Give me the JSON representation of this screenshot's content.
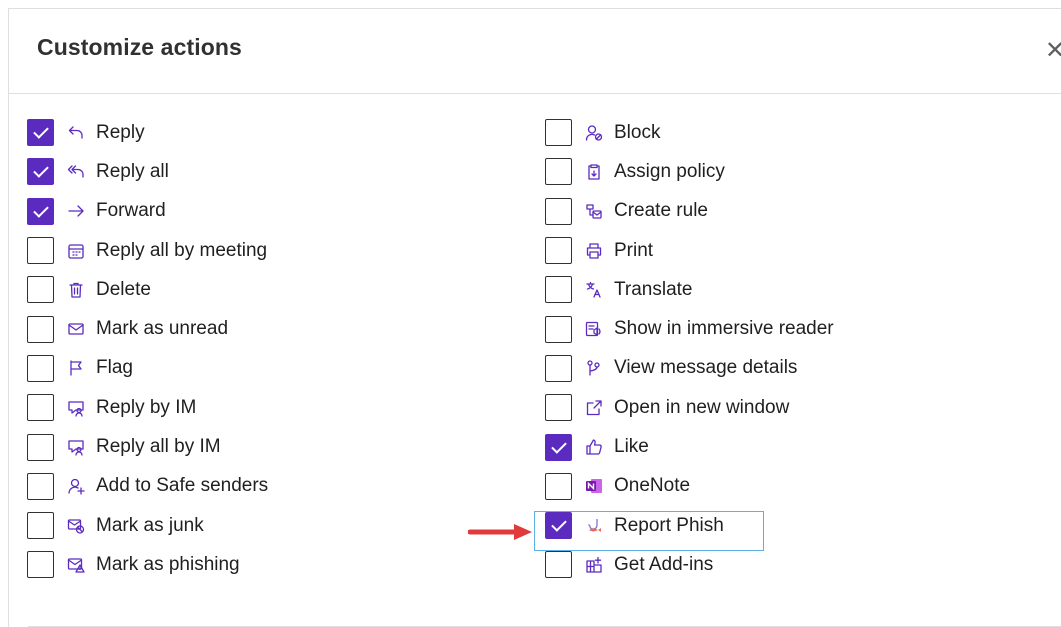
{
  "dialog": {
    "title": "Customize actions",
    "close_glyph": "✕"
  },
  "left_actions": [
    {
      "label": "Reply",
      "checked": true,
      "icon": "reply-icon"
    },
    {
      "label": "Reply all",
      "checked": true,
      "icon": "reply-all-icon"
    },
    {
      "label": "Forward",
      "checked": true,
      "icon": "forward-icon"
    },
    {
      "label": "Reply all by meeting",
      "checked": false,
      "icon": "calendar-icon"
    },
    {
      "label": "Delete",
      "checked": false,
      "icon": "trash-icon"
    },
    {
      "label": "Mark as unread",
      "checked": false,
      "icon": "envelope-icon"
    },
    {
      "label": "Flag",
      "checked": false,
      "icon": "flag-icon"
    },
    {
      "label": "Reply by IM",
      "checked": false,
      "icon": "chat-person-icon"
    },
    {
      "label": "Reply all by IM",
      "checked": false,
      "icon": "chat-person-icon"
    },
    {
      "label": "Add to Safe senders",
      "checked": false,
      "icon": "person-add-icon"
    },
    {
      "label": "Mark as junk",
      "checked": false,
      "icon": "junk-mail-icon"
    },
    {
      "label": "Mark as phishing",
      "checked": false,
      "icon": "phishing-mail-icon"
    }
  ],
  "right_actions": [
    {
      "label": "Block",
      "checked": false,
      "icon": "block-person-icon"
    },
    {
      "label": "Assign policy",
      "checked": false,
      "icon": "clipboard-icon"
    },
    {
      "label": "Create rule",
      "checked": false,
      "icon": "rule-icon"
    },
    {
      "label": "Print",
      "checked": false,
      "icon": "print-icon"
    },
    {
      "label": "Translate",
      "checked": false,
      "icon": "translate-icon"
    },
    {
      "label": "Show in immersive reader",
      "checked": false,
      "icon": "immersive-reader-icon"
    },
    {
      "label": "View message details",
      "checked": false,
      "icon": "message-details-icon"
    },
    {
      "label": "Open in new window",
      "checked": false,
      "icon": "open-window-icon"
    },
    {
      "label": "Like",
      "checked": true,
      "icon": "thumbs-up-icon"
    },
    {
      "label": "OneNote",
      "checked": false,
      "icon": "onenote-icon"
    },
    {
      "label": "Report Phish",
      "checked": true,
      "icon": "report-phish-icon"
    },
    {
      "label": "Get Add-ins",
      "checked": false,
      "icon": "add-ins-icon"
    }
  ],
  "colors": {
    "checkbox_checked": "#5b2bbf",
    "icon_stroke": "#5b2bbf",
    "highlight_border": "#5fb0e6",
    "arrow": "#e03a3a",
    "onenote": "#7719aa"
  }
}
